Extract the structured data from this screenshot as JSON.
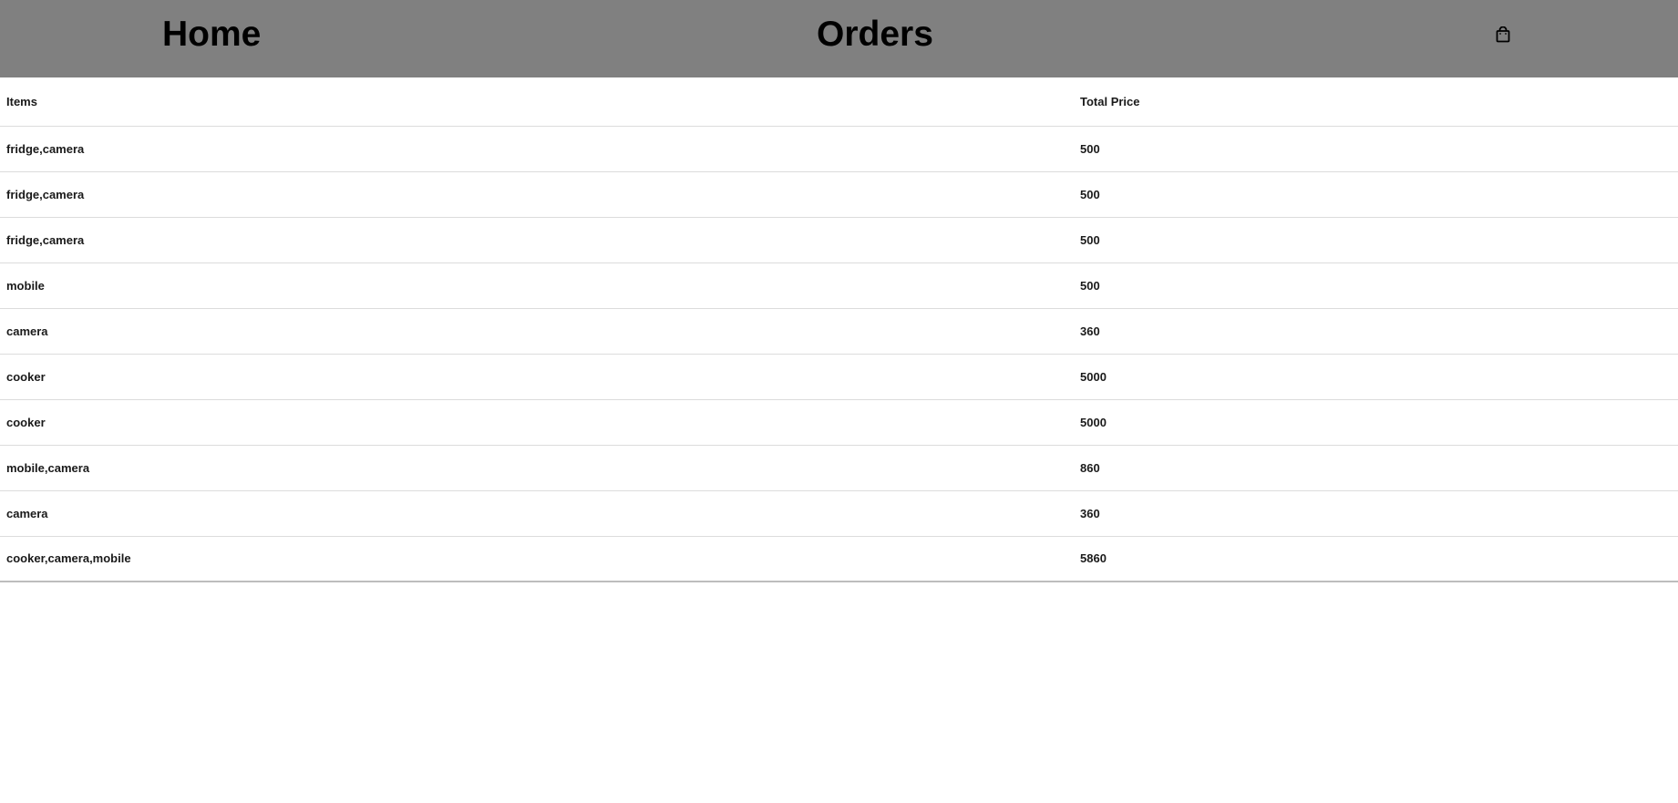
{
  "nav": {
    "home_label": "Home",
    "orders_label": "Orders",
    "cart_icon": "shopping-bag-icon"
  },
  "table": {
    "headers": [
      "Items",
      "Total Price"
    ],
    "rows": [
      [
        "fridge,camera",
        "500"
      ],
      [
        "fridge,camera",
        "500"
      ],
      [
        "fridge,camera",
        "500"
      ],
      [
        "mobile",
        "500"
      ],
      [
        "camera",
        "360"
      ],
      [
        "cooker",
        "5000"
      ],
      [
        "cooker",
        "5000"
      ],
      [
        "mobile,camera",
        "860"
      ],
      [
        "camera",
        "360"
      ],
      [
        "cooker,camera,mobile",
        "5860"
      ]
    ]
  },
  "colors": {
    "navbar_bg": "#808080",
    "row_border": "#dcdcdc"
  }
}
